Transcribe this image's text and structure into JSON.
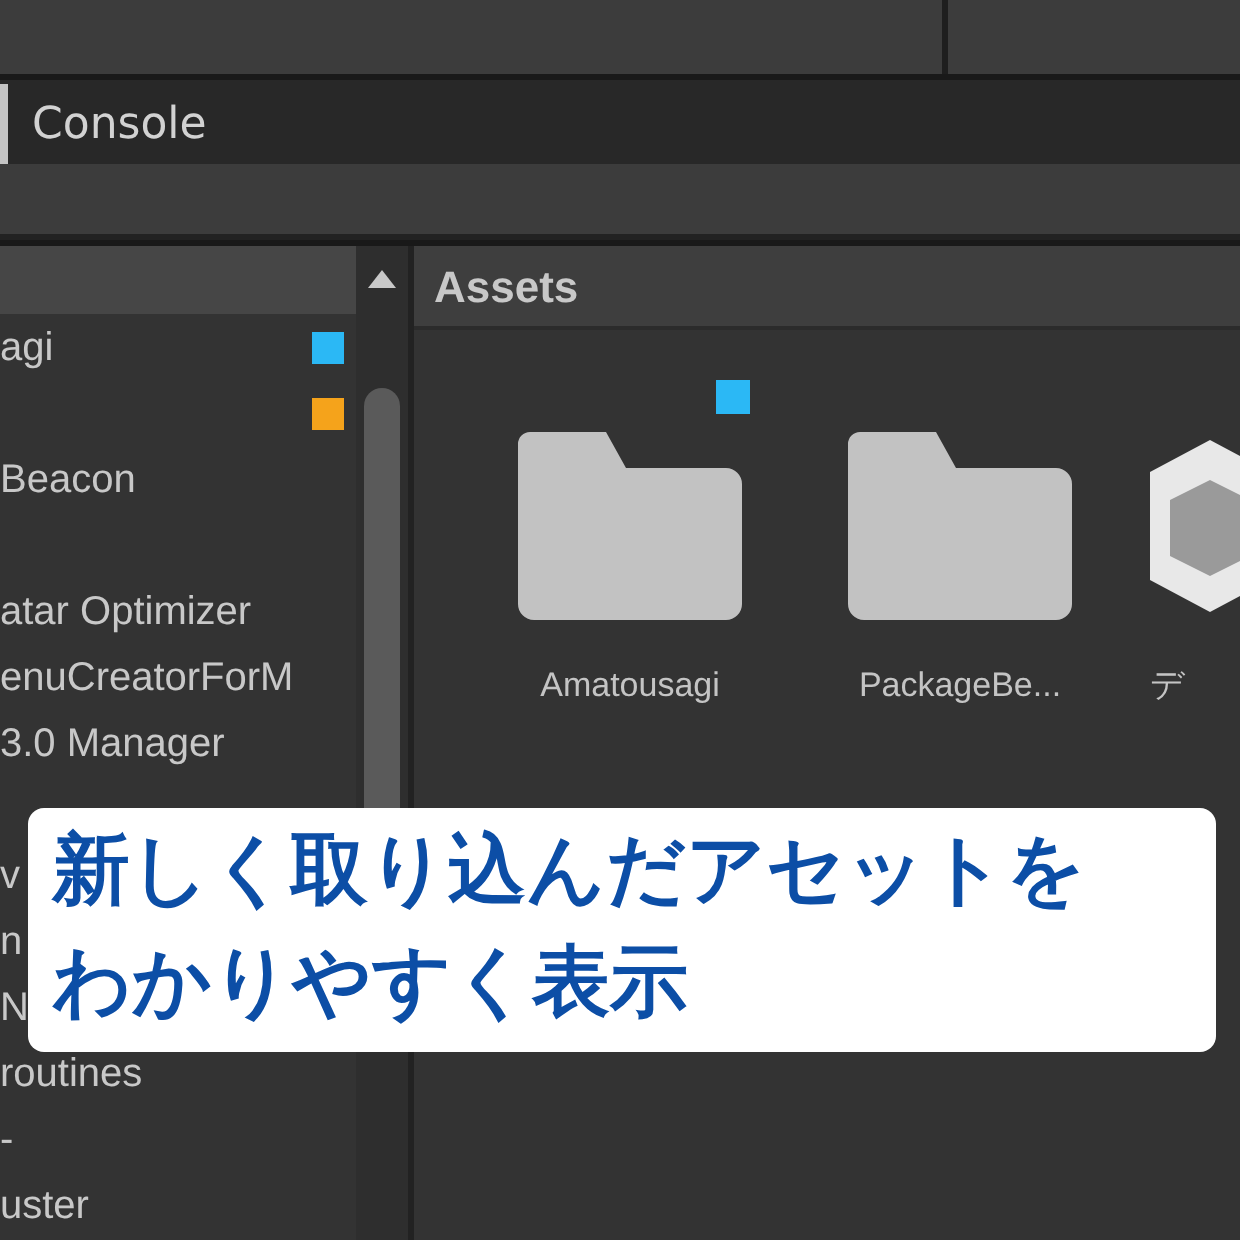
{
  "tabs": [
    {
      "label": "Console",
      "selected": true
    }
  ],
  "project_tree": {
    "items": [
      {
        "kind": "item",
        "label": "agi",
        "color": "#2bb8f5"
      },
      {
        "kind": "item",
        "color": "#f5a31b"
      },
      {
        "kind": "item",
        "label": "Beacon"
      },
      {
        "kind": "blank"
      },
      {
        "kind": "item",
        "label": "atar Optimizer"
      },
      {
        "kind": "item",
        "label": "enuCreatorForM"
      },
      {
        "kind": "item",
        "label": "3.0 Manager"
      },
      {
        "kind": "blank"
      },
      {
        "kind": "item",
        "label": "v"
      },
      {
        "kind": "item",
        "label": "n"
      },
      {
        "kind": "item",
        "label": "N"
      },
      {
        "kind": "item",
        "label": "routines"
      },
      {
        "kind": "item",
        "label": "-"
      },
      {
        "kind": "item",
        "label": "uster"
      }
    ]
  },
  "assets": {
    "title": "Assets",
    "items": [
      {
        "kind": "folder",
        "label": "Amatousagi",
        "color": "#2bb8f5"
      },
      {
        "kind": "folder",
        "label": "PackageBe..."
      },
      {
        "kind": "package",
        "label": "デ"
      }
    ]
  },
  "caption": "新しく取り込んだアセットをわかりやすく表示"
}
